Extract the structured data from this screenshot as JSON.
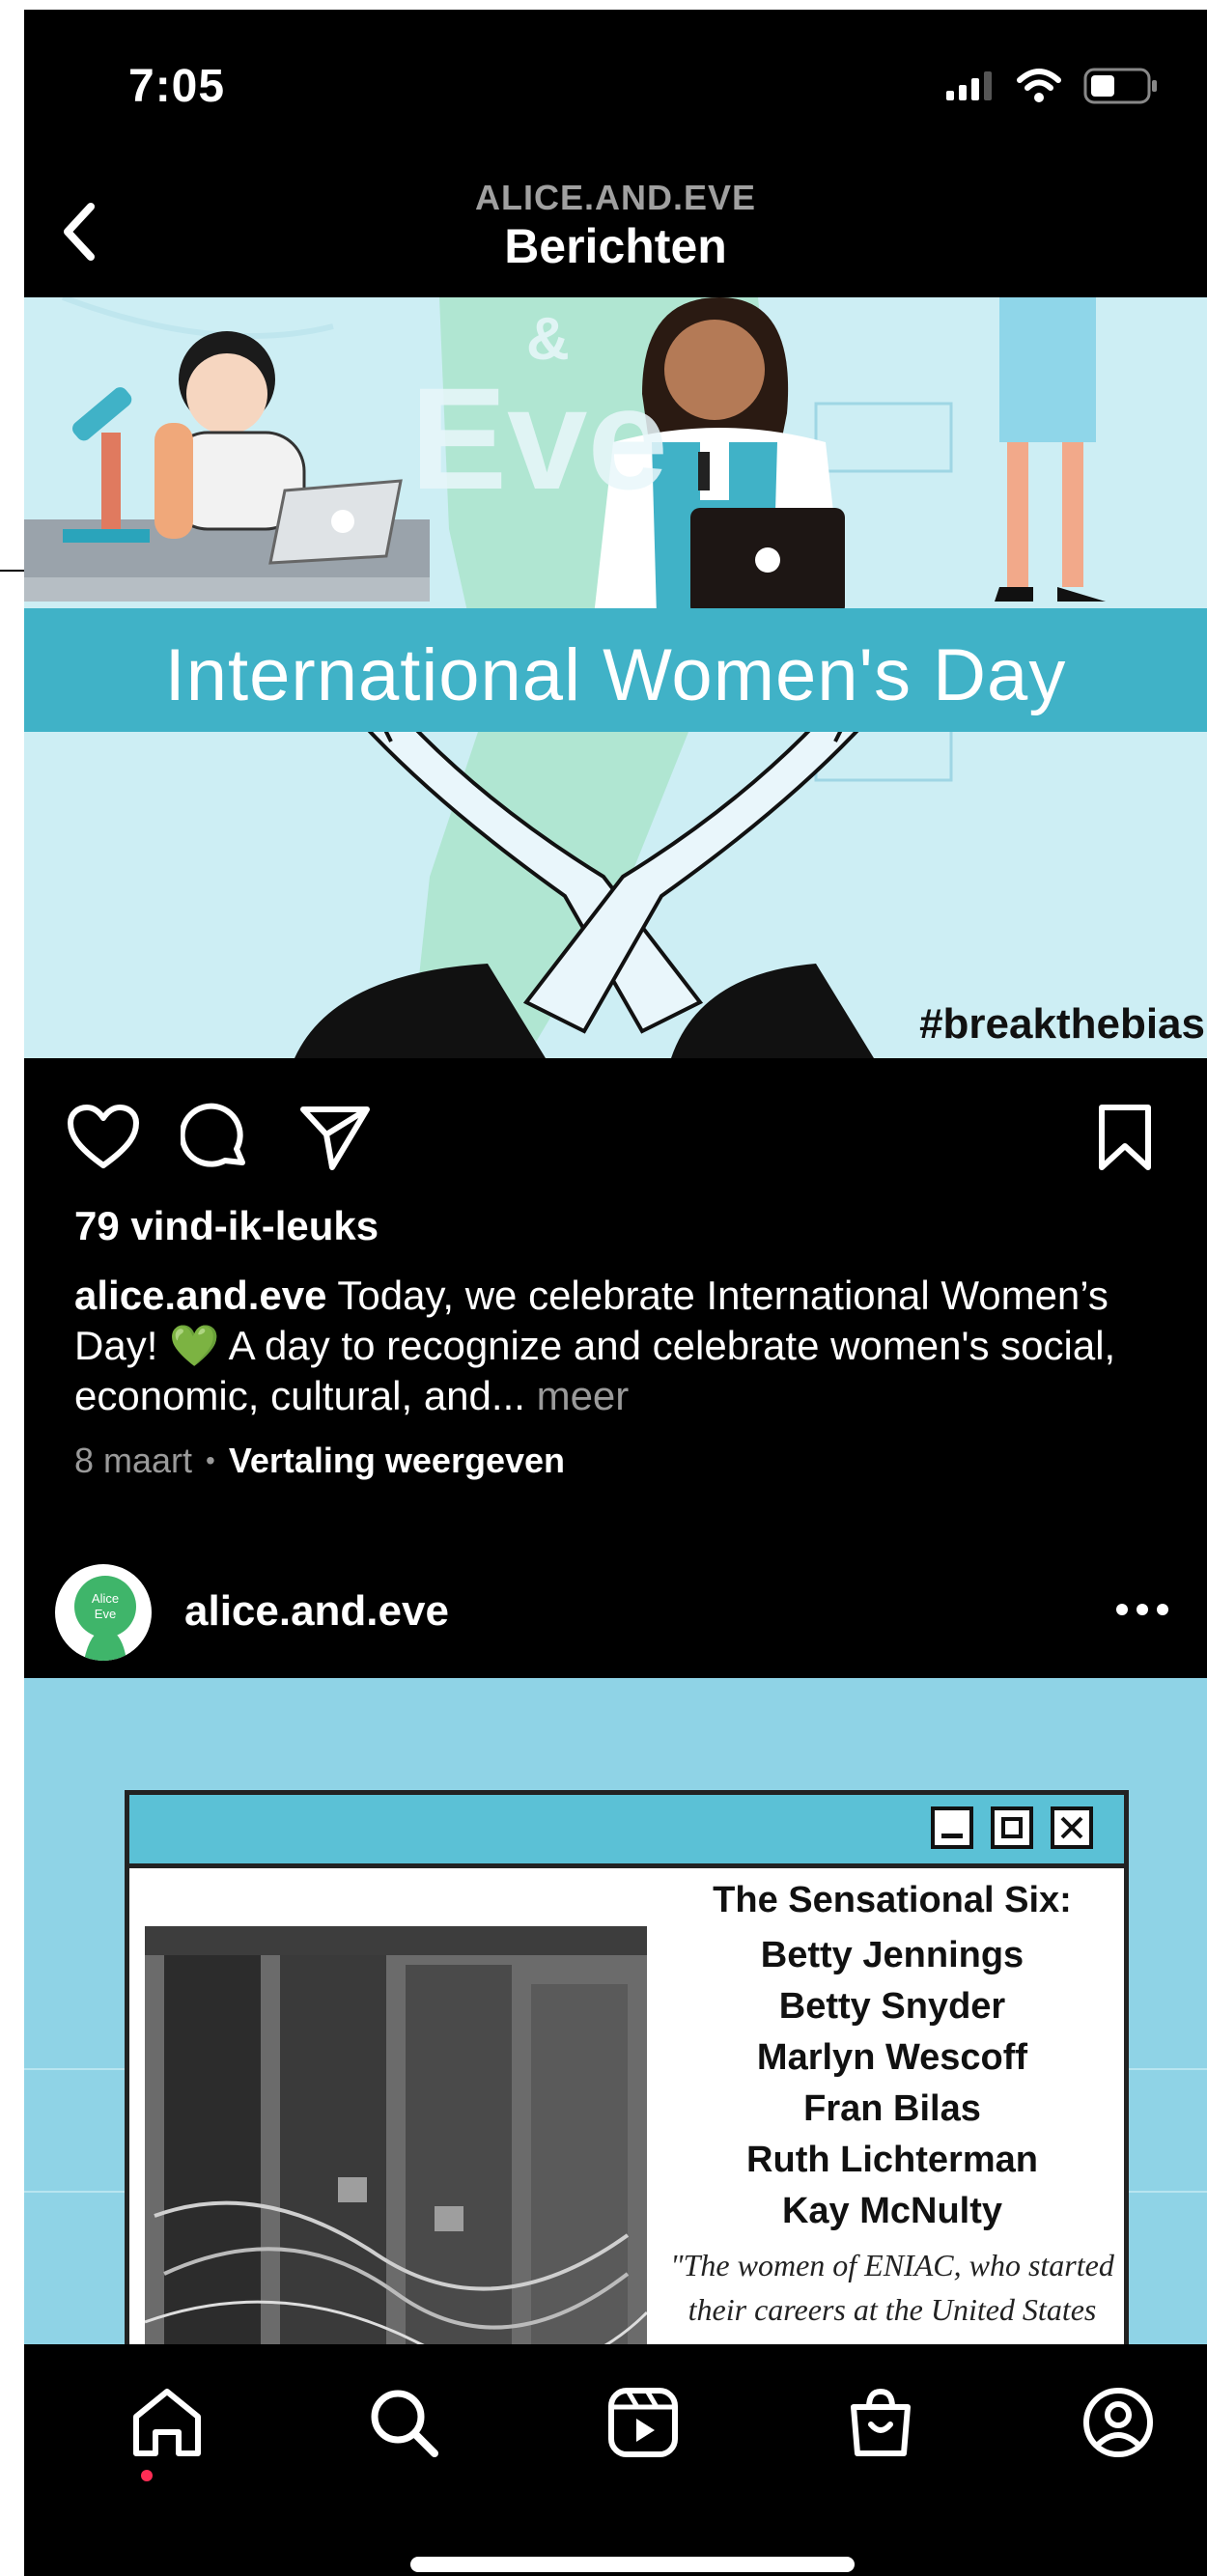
{
  "status_bar": {
    "time": "7:05"
  },
  "header": {
    "account": "ALICE.AND.EVE",
    "title": "Berichten"
  },
  "post1": {
    "image": {
      "banner_text": "International Women's Day",
      "hashtag": "#breakthebias",
      "logo_fragment": "Eve",
      "ampersand": "&"
    },
    "likes": "79 vind-ik-leuks",
    "caption_user": "alice.and.eve",
    "caption_text": " Today, we celebrate International Women’s Day! 💚 A day to recognize and celebrate women's social, economic, cultural, and... ",
    "caption_more": "meer",
    "date": "8 maart",
    "translate": "Vertaling weergeven"
  },
  "post2": {
    "username": "alice.and.eve",
    "avatar_text": "Alice Eve",
    "image": {
      "title": "The Sensational Six:",
      "names": [
        "Betty Jennings",
        "Betty Snyder",
        "Marlyn Wescoff",
        "Fran Bilas",
        "Ruth Lichterman",
        "Kay McNulty"
      ],
      "quote_line1": "\"The women of ENIAC, who started",
      "quote_line2": "their careers at the United States"
    }
  },
  "colors": {
    "background": "#000000",
    "accent_dot": "#ff2d55",
    "banner": "#40b2c7",
    "image_bg": "#cdeef4",
    "image2_bg": "#8fd3e6"
  },
  "icons": [
    "back-arrow-icon",
    "heart-icon",
    "comment-icon",
    "send-icon",
    "bookmark-icon",
    "more-dots-icon",
    "home-icon",
    "search-icon",
    "reels-icon",
    "shop-icon",
    "profile-icon"
  ]
}
